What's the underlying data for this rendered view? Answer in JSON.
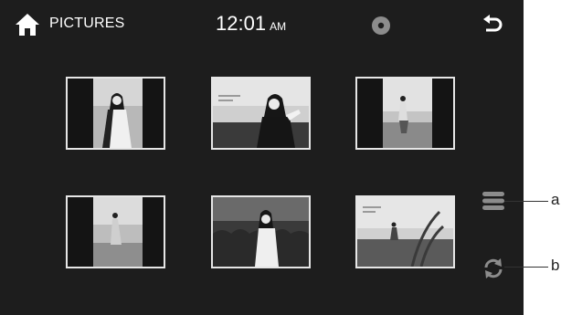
{
  "header": {
    "title": "PICTURES",
    "time": "12:01",
    "ampm": "AM",
    "icons": {
      "home": "home-icon",
      "disc": "disc-icon",
      "back": "back-arrow-icon"
    }
  },
  "thumbnails": [
    {
      "style": "portrait"
    },
    {
      "style": "landscape"
    },
    {
      "style": "portrait"
    },
    {
      "style": "portrait"
    },
    {
      "style": "landscape"
    },
    {
      "style": "landscape"
    }
  ],
  "side_controls": {
    "menu_icon": "list-menu-icon",
    "refresh_icon": "refresh-icon"
  },
  "callouts": {
    "a": "a",
    "b": "b"
  },
  "colors": {
    "screen_bg": "#1d1d1d",
    "thumb_border": "#e6e6e6",
    "icon_gray": "#8c8c8c"
  }
}
